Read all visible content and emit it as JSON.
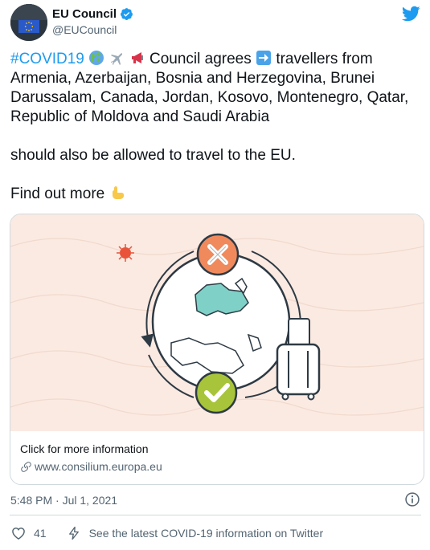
{
  "author": {
    "display_name": "EU Council",
    "handle": "@EUCouncil",
    "verified_icon": "verified-badge-icon",
    "avatar_icon": "eu-flag-avatar-icon"
  },
  "tweet": {
    "hashtag": "#COVID19",
    "line1_rest": " Council agrees ",
    "line1_after_arrow": " travellers from Armenia, Azerbaijan, Bosnia and Herzegovina, Brunei Darussalam, Canada, Jordan, Kosovo, Montenegro, Qatar, Republic of Moldova and Saudi Arabia",
    "line2": "should also be allowed to travel to the EU.",
    "line3": "Find out more",
    "emojis": [
      "globe-icon",
      "airplane-icon",
      "megaphone-icon",
      "right-arrow-icon",
      "pointing-down-icon"
    ]
  },
  "card": {
    "title": "Click for more information",
    "domain": "www.consilium.europa.eu",
    "image_icon": "travel-restrictions-illustration"
  },
  "footer": {
    "timestamp": "5:48 PM · Jul 1, 2021",
    "like_count": "41",
    "covid_info": "See the latest COVID-19 information on Twitter"
  },
  "colors": {
    "brand_blue": "#1d9bf0",
    "card_bg": "#fbeae2",
    "cross_orange": "#f08a5d",
    "check_green": "#a8c43a",
    "map_teal": "#7fd1c7"
  }
}
